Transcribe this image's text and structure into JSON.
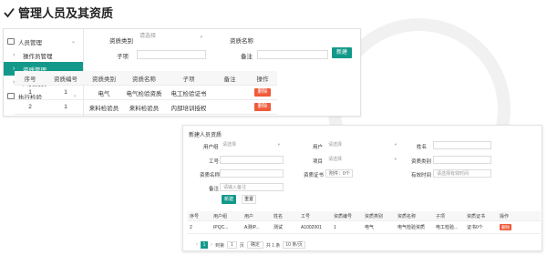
{
  "heading": {
    "title": "管理人员及其资质"
  },
  "sidebar": {
    "group1": "人员管理",
    "items": [
      "操作员管理",
      "资质管理",
      "人员资质"
    ],
    "group2": "执行检验"
  },
  "filter": {
    "type_label": "资质类别",
    "type_placeholder": "请选择",
    "name_label": "资质名称",
    "sub_label": "子项",
    "note_label": "备注",
    "new_button": "新建"
  },
  "table": {
    "headers": [
      "序号",
      "资质编号",
      "资质类别",
      "资质名称",
      "子项",
      "备注",
      "操作"
    ],
    "rows": [
      {
        "no": "1",
        "code": "1",
        "type": "电气",
        "name": "电气检验资质",
        "sub": "电工检验证书",
        "note": "",
        "action": "删除"
      },
      {
        "no": "2",
        "code": "1",
        "type": "来料检验员",
        "name": "来料检验员",
        "sub": "内部培训授权",
        "note": "",
        "action": "删除"
      }
    ]
  },
  "dialog": {
    "title": "新建人员资质",
    "user_group_label": "用户组",
    "user_group_ph": "请选择",
    "user_label": "用户",
    "user_ph": "请选择",
    "name_label": "姓名",
    "id_label": "工号",
    "item_label": "项目",
    "item_ph": "请选择",
    "type_label": "资质类别",
    "qual_name_label": "资质名称",
    "cert_label": "资质证书",
    "cert_value": "附件：0个",
    "valid_label": "有效时间",
    "valid_ph": "请选择有效时间",
    "note_label": "备注",
    "note_ph": "请输入备注",
    "new_button": "新建",
    "reset_button": "重置",
    "headers": [
      "序号",
      "用户组",
      "用户",
      "姓名",
      "工号",
      "资质编号",
      "资质类别",
      "资质名称",
      "子项",
      "资质证书",
      "操作"
    ],
    "row": [
      "2",
      "IPQC...",
      "A测IP...",
      "测试",
      "A1002001",
      "1",
      "电气",
      "电气检验资质",
      "电工检验...",
      "证书0个",
      "删除"
    ],
    "pager": {
      "page": "1",
      "goto_label": "到第",
      "goto_value": "1",
      "page_unit": "页",
      "confirm": "确定",
      "total": "共 1 条",
      "per_page": "10 条/页"
    }
  },
  "colors": {
    "accent": "#13998a",
    "danger": "#f05a3a"
  }
}
